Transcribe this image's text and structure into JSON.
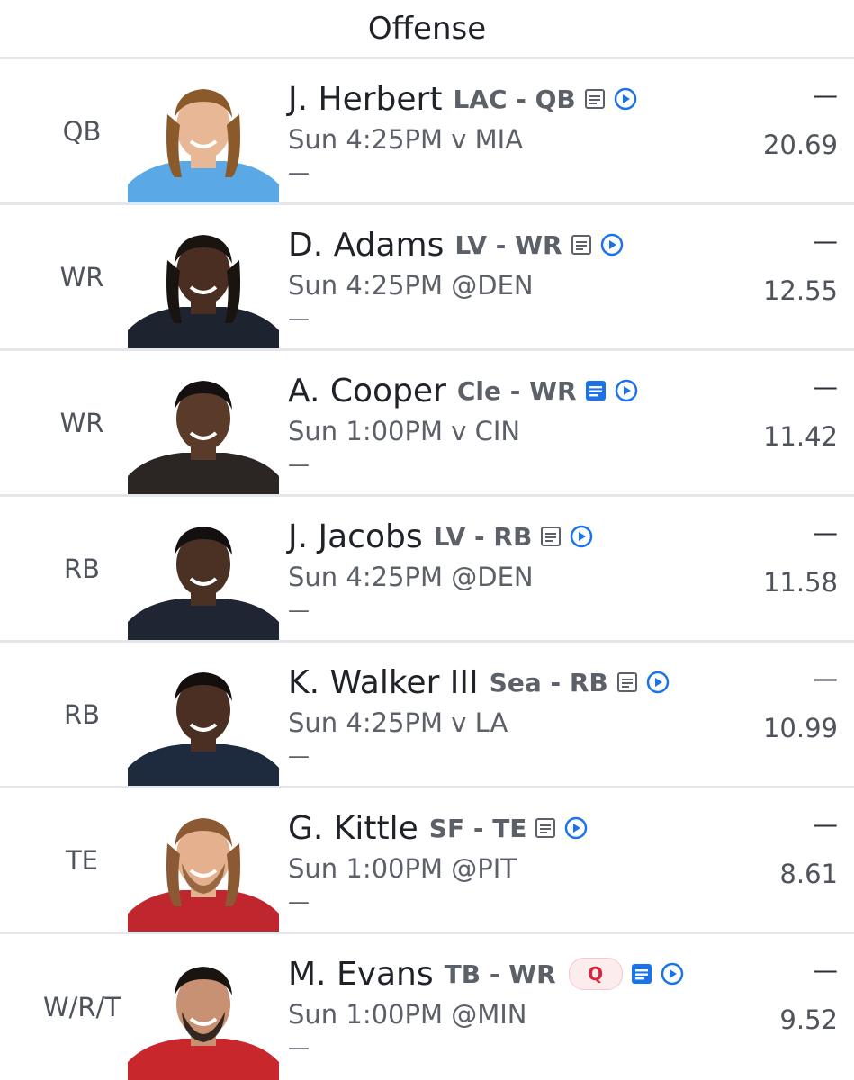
{
  "header": {
    "title": "Offense"
  },
  "colors": {
    "accent": "#1a73e8",
    "text": "#1f2329",
    "muted": "#5c6068",
    "divider": "#e4e6ea",
    "badge_q": "#d7263d"
  },
  "players": [
    {
      "slot": "QB",
      "name": "J. Herbert",
      "team_pos": "LAC - QB",
      "game": "Sun 4:25PM v MIA",
      "stat": "—",
      "proj_label": "—",
      "proj": "20.69",
      "note_icon": "note-outline",
      "status": ""
    },
    {
      "slot": "WR",
      "name": "D. Adams",
      "team_pos": "LV - WR",
      "game": "Sun 4:25PM @DEN",
      "stat": "—",
      "proj_label": "—",
      "proj": "12.55",
      "note_icon": "note-outline",
      "status": ""
    },
    {
      "slot": "WR",
      "name": "A. Cooper",
      "team_pos": "Cle - WR",
      "game": "Sun 1:00PM v CIN",
      "stat": "—",
      "proj_label": "—",
      "proj": "11.42",
      "note_icon": "note-filled",
      "status": ""
    },
    {
      "slot": "RB",
      "name": "J. Jacobs",
      "team_pos": "LV - RB",
      "game": "Sun 4:25PM @DEN",
      "stat": "—",
      "proj_label": "—",
      "proj": "11.58",
      "note_icon": "note-outline",
      "status": ""
    },
    {
      "slot": "RB",
      "name": "K. Walker III",
      "team_pos": "Sea - RB",
      "game": "Sun 4:25PM v LA",
      "stat": "—",
      "proj_label": "—",
      "proj": "10.99",
      "note_icon": "note-outline",
      "status": ""
    },
    {
      "slot": "TE",
      "name": "G. Kittle",
      "team_pos": "SF - TE",
      "game": "Sun 1:00PM @PIT",
      "stat": "—",
      "proj_label": "—",
      "proj": "8.61",
      "note_icon": "note-outline",
      "status": ""
    },
    {
      "slot": "W/R/T",
      "name": "M. Evans",
      "team_pos": "TB - WR",
      "game": "Sun 1:00PM @MIN",
      "stat": "—",
      "proj_label": "—",
      "proj": "9.52",
      "note_icon": "note-filled",
      "status": "Q"
    }
  ]
}
